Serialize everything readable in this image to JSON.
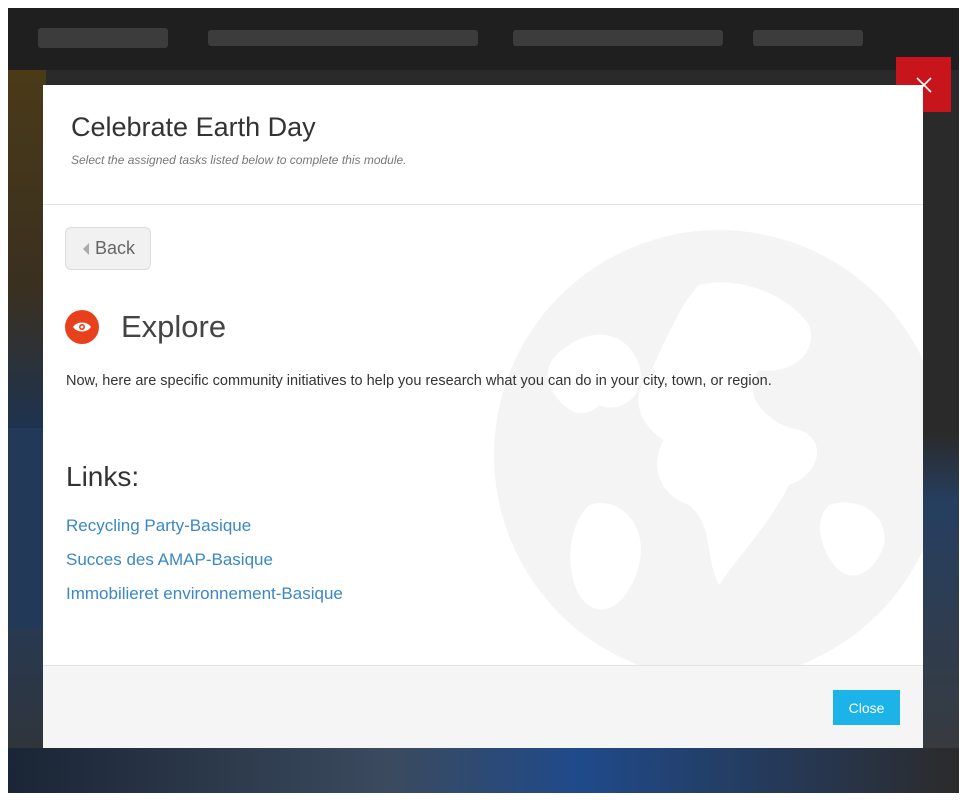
{
  "modal": {
    "title": "Celebrate Earth Day",
    "subtitle": "Select the assigned tasks listed below to complete this module.",
    "dismiss_icon": "close-icon"
  },
  "body": {
    "back_label": "Back",
    "back_icon": "chevron-left-icon",
    "section_icon": "eye-icon",
    "section_title": "Explore",
    "description": "Now, here are specific community initiatives to help you research what you can do in your city, town, or region.",
    "links_heading": "Links:",
    "links": [
      "Recycling Party-Basique",
      "Succes des AMAP-Basique",
      "Immobilieret environnement-Basique"
    ]
  },
  "footer": {
    "close_label": "Close"
  },
  "colors": {
    "dismiss_bg": "#c8141b",
    "section_badge": "#e8401c",
    "link": "#3a88c4",
    "close_button": "#1bb3e8"
  }
}
